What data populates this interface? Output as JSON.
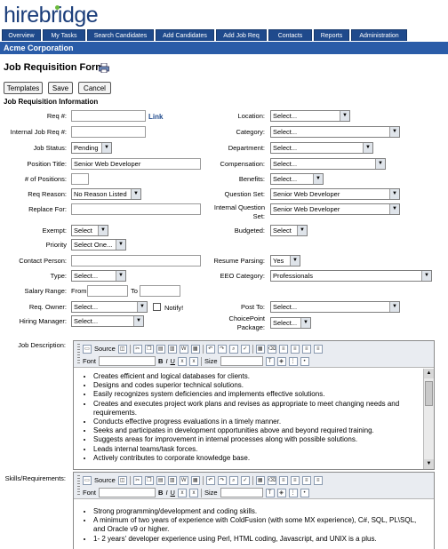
{
  "app": {
    "logo": "hirebridge",
    "company": "Acme Corporation"
  },
  "nav": [
    "Overview",
    "My Tasks",
    "Search Candidates",
    "Add Candidates",
    "Add Job Req",
    "Contacts",
    "Reports",
    "Administration"
  ],
  "page": {
    "title": "Job Requisition Form",
    "section": "Job Requisition Information"
  },
  "buttons": {
    "templates": "Templates",
    "save": "Save",
    "cancel": "Cancel"
  },
  "fields": {
    "req_num": {
      "label": "Req #:",
      "value": ""
    },
    "req_link": "Link",
    "internal_req": {
      "label": "Internal Job Req #:",
      "value": ""
    },
    "job_status": {
      "label": "Job Status:",
      "value": "Pending"
    },
    "position_title": {
      "label": "Position Title:",
      "value": "Senior Web Developer"
    },
    "num_positions": {
      "label": "# of Positions:",
      "value": ""
    },
    "req_reason": {
      "label": "Req Reason:",
      "value": "No Reason Listed"
    },
    "replace_for": {
      "label": "Replace For:",
      "value": ""
    },
    "exempt": {
      "label": "Exempt:",
      "value": "Select"
    },
    "priority": {
      "label": "Priority",
      "value": "Select One..."
    },
    "contact_person": {
      "label": "Contact Person:",
      "value": ""
    },
    "type": {
      "label": "Type:",
      "value": "Select..."
    },
    "salary_range": {
      "label": "Salary Range:",
      "from": "From",
      "to": "To"
    },
    "req_owner": {
      "label": "Req. Owner:",
      "value": "Select...",
      "notify": "Notify!"
    },
    "hiring_manager": {
      "label": "Hiring Manager:",
      "value": "Select..."
    },
    "location": {
      "label": "Location:",
      "value": "Select..."
    },
    "category": {
      "label": "Category:",
      "value": "Select..."
    },
    "department": {
      "label": "Department:",
      "value": "Select..."
    },
    "compensation": {
      "label": "Compensation:",
      "value": "Select..."
    },
    "benefits": {
      "label": "Benefits:",
      "value": "Select..."
    },
    "question_set": {
      "label": "Question Set:",
      "value": "Senior Web Developer"
    },
    "internal_question_set": {
      "label": "Internal Question Set:",
      "value": "Senior Web Developer"
    },
    "budgeted": {
      "label": "Budgeted:",
      "value": "Select"
    },
    "resume_parsing": {
      "label": "Resume Parsing:",
      "value": "Yes"
    },
    "eeo_category": {
      "label": "EEO Category:",
      "value": "Professionals"
    },
    "post_to": {
      "label": "Post To:",
      "value": "Select..."
    },
    "choicepoint": {
      "label": "ChoicePoint Package:",
      "value": "Select..."
    }
  },
  "editor": {
    "source": "Source",
    "font": "Font",
    "size": "Size",
    "b": "B",
    "i": "I",
    "u": "U"
  },
  "job_description": {
    "label": "Job Description:",
    "items": [
      "Creates efficient and logical databases for clients.",
      "Designs and codes superior technical solutions.",
      "Easily recognizes system deficiencies and implements effective solutions.",
      "Creates and executes project work plans and revises as appropriate to meet changing needs and requirements.",
      "Conducts effective progress evaluations in a timely manner.",
      "Seeks and participates in development opportunities above and beyond required training.",
      "Suggests areas for improvement in internal processes along with possible solutions.",
      "Leads internal teams/task forces.",
      "Actively contributes to corporate knowledge base."
    ]
  },
  "skills": {
    "label": "Skills/Requirements:",
    "items": [
      "Strong programming/development and coding skills.",
      "A minimum of two years of experience with ColdFusion (with some MX experience), C#, SQL, PL\\SQL, and Oracle v9 or higher.",
      "1- 2 years' developer experience using Perl, HTML coding, Javascript, and UNIX is a plus."
    ]
  }
}
